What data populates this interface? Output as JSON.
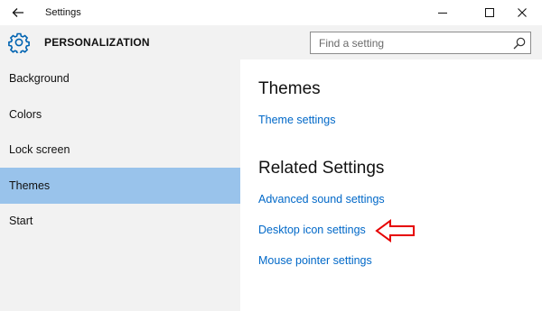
{
  "window": {
    "back_icon": "back-arrow-icon",
    "title": "Settings",
    "controls": [
      "minimize-icon",
      "maximize-icon",
      "close-icon"
    ]
  },
  "header": {
    "icon": "gear-icon",
    "title": "PERSONALIZATION",
    "search_placeholder": "Find a setting",
    "search_icon": "search-icon"
  },
  "sidebar": {
    "items": [
      {
        "label": "Background",
        "selected": false
      },
      {
        "label": "Colors",
        "selected": false
      },
      {
        "label": "Lock screen",
        "selected": false
      },
      {
        "label": "Themes",
        "selected": true
      },
      {
        "label": "Start",
        "selected": false
      }
    ]
  },
  "main": {
    "heading": "Themes",
    "theme_link": "Theme settings",
    "related_heading": "Related Settings",
    "related_links": [
      "Advanced sound settings",
      "Desktop icon settings",
      "Mouse pointer settings"
    ],
    "annotation_icon": "red-arrow-icon"
  },
  "colors": {
    "accent": "#0068c8",
    "selection": "#99c3eb",
    "sidebar_bg": "#f2f2f2",
    "annotation": "#e60000"
  }
}
